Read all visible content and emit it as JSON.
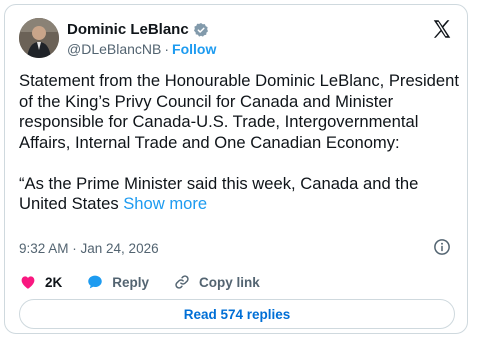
{
  "author": {
    "name": "Dominic LeBlanc",
    "handle": "@DLeBlancNB",
    "separator": "·",
    "follow_label": "Follow"
  },
  "tweet": {
    "text": "Statement from the Honourable Dominic LeBlanc, President of the King’s Privy Council for Canada and Minister responsible for Canada-U.S. Trade, Intergovernmental Affairs, Internal Trade and One Canadian Economy:\n\n“As the Prime Minister said this week, Canada and the United States ",
    "show_more_label": "Show more",
    "timestamp": "9:32 AM · Jan 24, 2026"
  },
  "actions": {
    "like_count": "2K",
    "reply_label": "Reply",
    "copy_link_label": "Copy link"
  },
  "read_replies_label": "Read 574 replies",
  "colors": {
    "accent": "#1d9bf0",
    "like": "#f91880",
    "reply_icon": "#1d9bf0",
    "text": "#0f1419",
    "muted": "#536471",
    "border": "#cfd9de"
  },
  "icons": [
    "verified-badge-icon",
    "x-logo-icon",
    "info-icon",
    "heart-icon",
    "reply-bubble-icon",
    "link-icon"
  ]
}
